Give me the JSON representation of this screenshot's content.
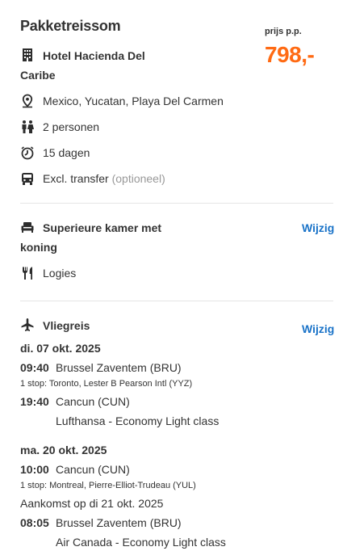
{
  "package": {
    "title": "Pakketreissom",
    "price_label": "prijs p.p.",
    "price": "798,-",
    "hotel_line1": "Hotel Hacienda Del",
    "hotel_line2": "Caribe",
    "location": "Mexico, Yucatan, Playa Del Carmen",
    "persons": "2 personen",
    "duration": "15 dagen",
    "transfer": "Excl. transfer",
    "transfer_note": "(optioneel)"
  },
  "room": {
    "name_line1": "Superieure kamer met",
    "name_line2": "koning",
    "change_label": "Wijzig",
    "board": "Logies"
  },
  "flight": {
    "title": "Vliegreis",
    "change_label": "Wijzig",
    "outbound": {
      "date": "di. 07 okt. 2025",
      "dep_time": "09:40",
      "dep_airport": "Brussel Zaventem (BRU)",
      "stop": "1 stop: Toronto, Lester B Pearson Intl (YYZ)",
      "arr_time": "19:40",
      "arr_airport": "Cancun (CUN)",
      "carrier": "Lufthansa - Economy Light class"
    },
    "return": {
      "date": "ma. 20 okt. 2025",
      "dep_time": "10:00",
      "dep_airport": "Cancun (CUN)",
      "stop": "1 stop: Montreal, Pierre-Elliot-Trudeau (YUL)",
      "arrival_note": "Aankomst op di 21 okt. 2025",
      "arr_time": "08:05",
      "arr_airport": "Brussel Zaventem (BRU)",
      "carrier": "Air Canada - Economy Light class"
    }
  },
  "colors": {
    "price": "#ff6a13",
    "link": "#1a73c8",
    "text": "#333333",
    "muted": "#999999"
  }
}
